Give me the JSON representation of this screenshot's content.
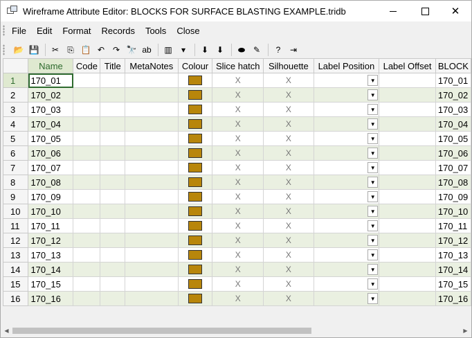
{
  "window": {
    "title": "Wireframe Attribute Editor: BLOCKS FOR SURFACE BLASTING EXAMPLE.tridb",
    "minimize": "",
    "maximize": "",
    "close": "✕"
  },
  "menu": [
    "File",
    "Edit",
    "Format",
    "Records",
    "Tools",
    "Close"
  ],
  "toolbar": [
    {
      "name": "open-icon",
      "glyph": "📂"
    },
    {
      "name": "save-icon",
      "glyph": "💾"
    },
    {
      "sep": true
    },
    {
      "name": "cut-icon",
      "glyph": "✂"
    },
    {
      "name": "copy-icon",
      "glyph": "⎘"
    },
    {
      "name": "paste-icon",
      "glyph": "📋"
    },
    {
      "name": "undo-icon",
      "glyph": "↶"
    },
    {
      "name": "redo-icon",
      "glyph": "↷"
    },
    {
      "name": "find-icon",
      "glyph": "🔭"
    },
    {
      "name": "find-replace-icon",
      "glyph": "ab"
    },
    {
      "sep": true
    },
    {
      "name": "columns-icon",
      "glyph": "▥"
    },
    {
      "name": "dropdown-icon",
      "glyph": "▾"
    },
    {
      "sep": true
    },
    {
      "name": "import-icon",
      "glyph": "⬇"
    },
    {
      "name": "export-icon",
      "glyph": "⬇"
    },
    {
      "sep": true
    },
    {
      "name": "shape-icon",
      "glyph": "⬬"
    },
    {
      "name": "edit-pen-icon",
      "glyph": "✎"
    },
    {
      "sep": true
    },
    {
      "name": "help-icon",
      "glyph": "?"
    },
    {
      "name": "exit-icon",
      "glyph": "⇥"
    }
  ],
  "columns": [
    "Name",
    "Code",
    "Title",
    "MetaNotes",
    "Colour",
    "Slice hatch",
    "Silhouette",
    "Label Position",
    "Label Offset",
    "BLOCK"
  ],
  "rows": [
    {
      "num": "1",
      "name": "170_01",
      "block": "170_01"
    },
    {
      "num": "2",
      "name": "170_02",
      "block": "170_02"
    },
    {
      "num": "3",
      "name": "170_03",
      "block": "170_03"
    },
    {
      "num": "4",
      "name": "170_04",
      "block": "170_04"
    },
    {
      "num": "5",
      "name": "170_05",
      "block": "170_05"
    },
    {
      "num": "6",
      "name": "170_06",
      "block": "170_06"
    },
    {
      "num": "7",
      "name": "170_07",
      "block": "170_07"
    },
    {
      "num": "8",
      "name": "170_08",
      "block": "170_08"
    },
    {
      "num": "9",
      "name": "170_09",
      "block": "170_09"
    },
    {
      "num": "10",
      "name": "170_10",
      "block": "170_10"
    },
    {
      "num": "11",
      "name": "170_11",
      "block": "170_11"
    },
    {
      "num": "12",
      "name": "170_12",
      "block": "170_12"
    },
    {
      "num": "13",
      "name": "170_13",
      "block": "170_13"
    },
    {
      "num": "14",
      "name": "170_14",
      "block": "170_14"
    },
    {
      "num": "15",
      "name": "170_15",
      "block": "170_15"
    },
    {
      "num": "16",
      "name": "170_16",
      "block": "170_16"
    }
  ],
  "cell_values": {
    "slice_hatch": "X",
    "silhouette": "X",
    "dropdown_arrow": "▼"
  },
  "colors": {
    "swatch": "#b8860b",
    "alt_row": "#eaf0e1",
    "selection": "#2e6b2e"
  },
  "scrollbar": {
    "left_arrow": "◀",
    "right_arrow": "▶"
  }
}
